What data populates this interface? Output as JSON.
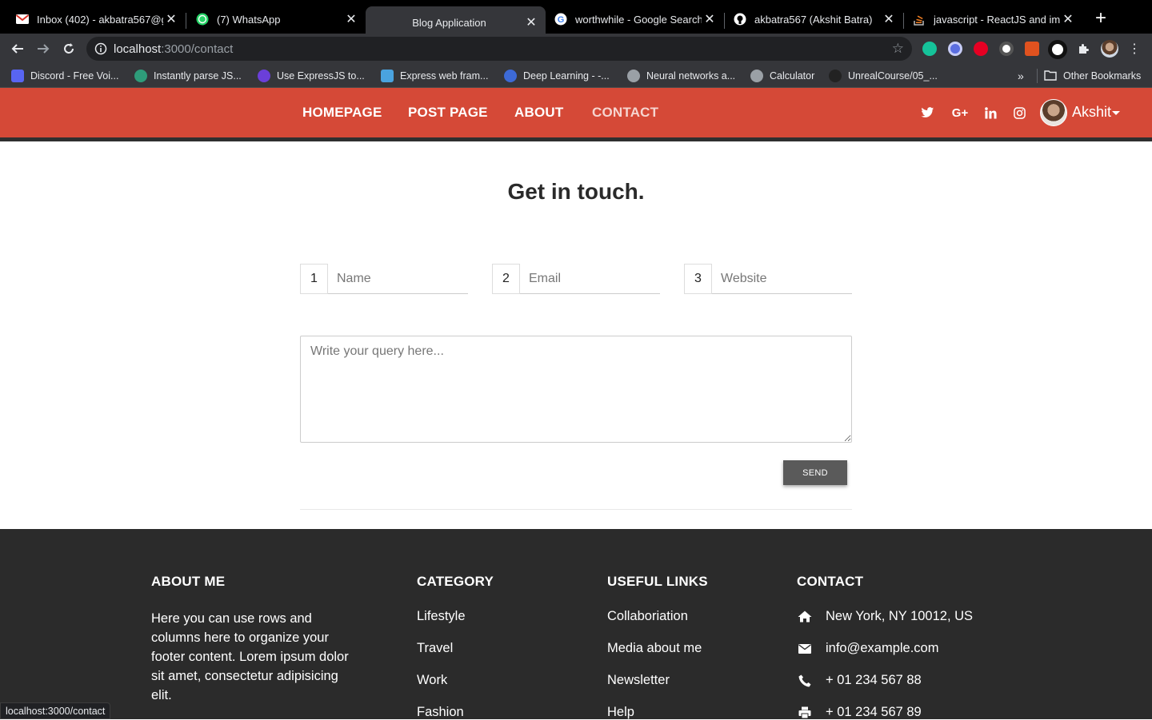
{
  "browser": {
    "tabs": [
      {
        "title": "Inbox (402) - akbatra567@g",
        "icon": "gmail-icon",
        "active": false
      },
      {
        "title": "(7) WhatsApp",
        "icon": "whatsapp-icon",
        "active": false
      },
      {
        "title": "Blog Application",
        "icon": "none",
        "active": true
      },
      {
        "title": "worthwhile - Google Search",
        "icon": "google-icon",
        "active": false
      },
      {
        "title": "akbatra567 (Akshit Batra)",
        "icon": "github-icon",
        "active": false
      },
      {
        "title": "javascript - ReactJS and ima",
        "icon": "stackoverflow-icon",
        "active": false
      }
    ],
    "url_host": "localhost",
    "url_path": ":3000/contact",
    "bookmarks": [
      {
        "label": "Discord - Free Voi...",
        "color": "#5865f2"
      },
      {
        "label": "Instantly parse JS...",
        "color": "#2e9c7a"
      },
      {
        "label": "Use ExpressJS to...",
        "color": "#6b3fd9"
      },
      {
        "label": "Express web fram...",
        "color": "#4aa3df"
      },
      {
        "label": "Deep Learning - -...",
        "color": "#3d6ad6"
      },
      {
        "label": "Neural networks a...",
        "color": "#9aa0a6"
      },
      {
        "label": "Calculator",
        "color": "#9aa0a6"
      },
      {
        "label": "UnrealCourse/05_...",
        "color": "#222222"
      }
    ],
    "other_bookmarks": "Other Bookmarks",
    "status_url": "localhost:3000/contact"
  },
  "nav": {
    "items": [
      "HOMEPAGE",
      "POST PAGE",
      "ABOUT",
      "CONTACT"
    ],
    "current": "CONTACT",
    "username": "Akshit",
    "accent": "#d54937"
  },
  "contact": {
    "heading": "Get in touch.",
    "fields": [
      {
        "number": "1",
        "placeholder": "Name"
      },
      {
        "number": "2",
        "placeholder": "Email"
      },
      {
        "number": "3",
        "placeholder": "Website"
      }
    ],
    "query_placeholder": "Write your query here...",
    "send_label": "SEND"
  },
  "footer": {
    "about_title": "ABOUT ME",
    "about_text": "Here you can use rows and columns here to organize your footer content. Lorem ipsum dolor sit amet, consectetur adipisicing elit.",
    "category_title": "CATEGORY",
    "categories": [
      "Lifestyle",
      "Travel",
      "Work",
      "Fashion"
    ],
    "links_title": "USEFUL LINKS",
    "links": [
      "Collaboriation",
      "Media about me",
      "Newsletter",
      "Help"
    ],
    "contact_title": "CONTACT",
    "contact_items": [
      {
        "icon": "home-icon",
        "text": "New York, NY 10012, US"
      },
      {
        "icon": "envelope-icon",
        "text": "info@example.com"
      },
      {
        "icon": "phone-icon",
        "text": "+ 01 234 567 88"
      },
      {
        "icon": "printer-icon",
        "text": "+ 01 234 567 89"
      }
    ]
  }
}
